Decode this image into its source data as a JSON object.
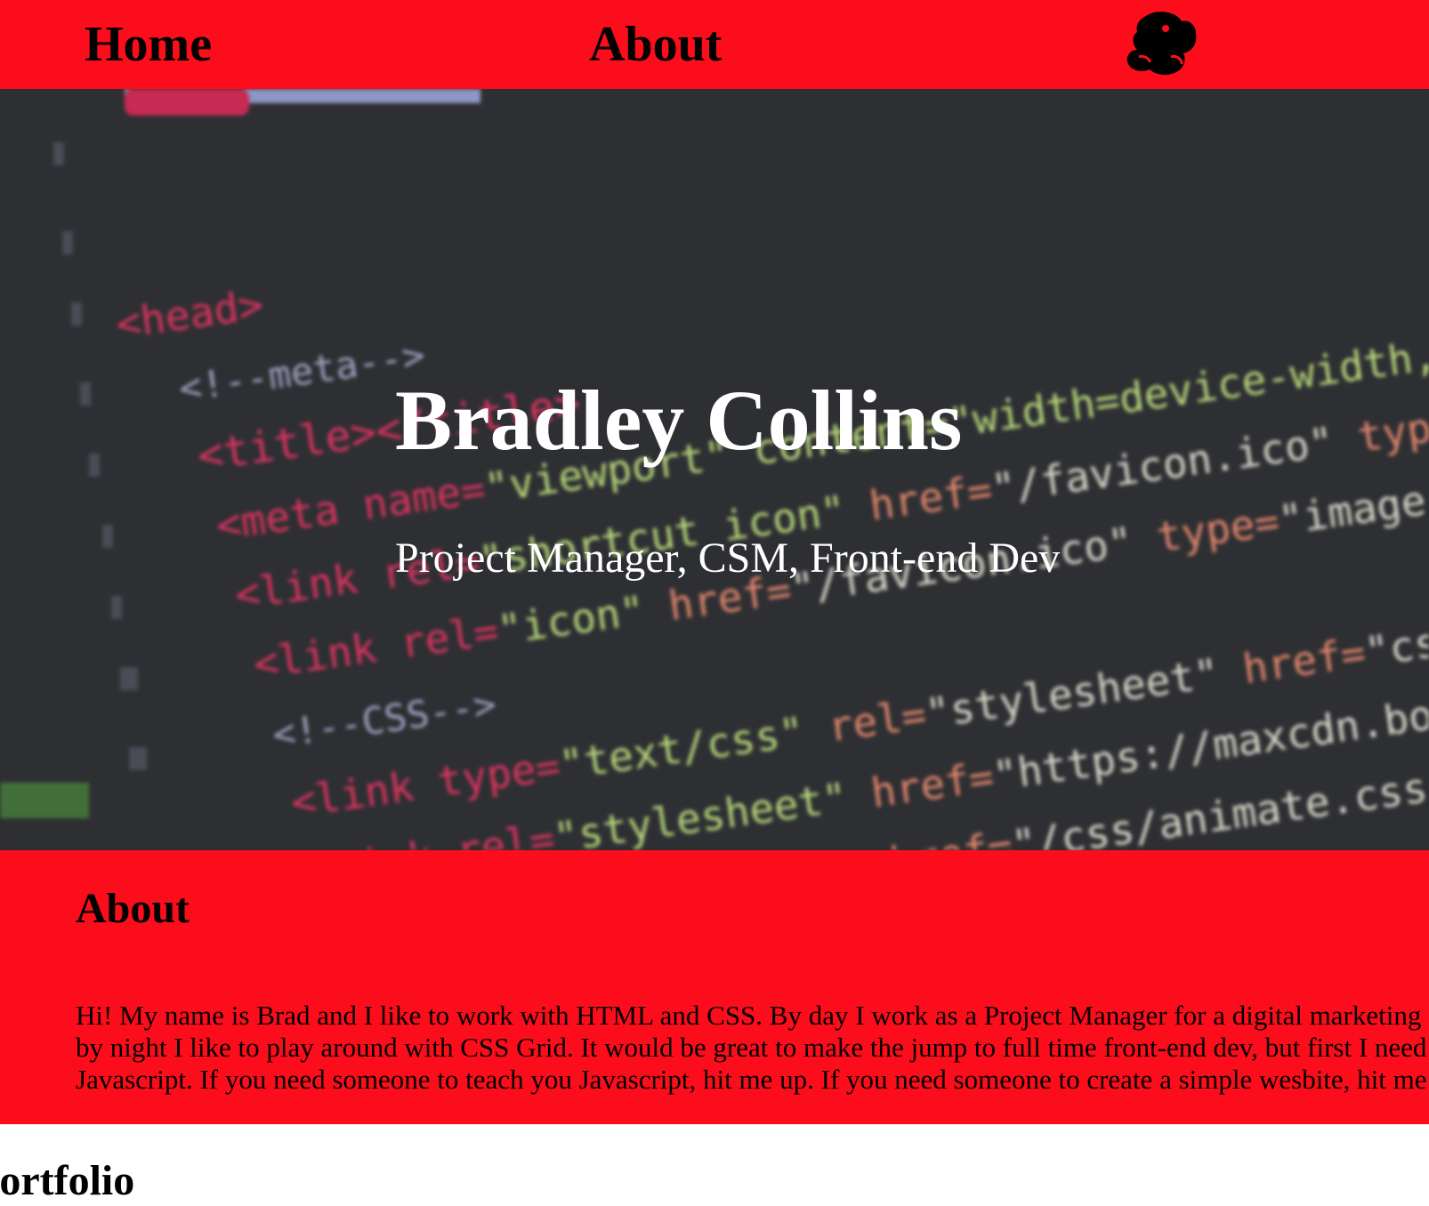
{
  "nav": {
    "home_label": "Home",
    "about_label": "About",
    "logo_icon": "mario-silhouette-icon"
  },
  "hero": {
    "title": "Bradley Collins",
    "subtitle": "Project Manager, CSM, Front-end Dev",
    "background": "blurred-html-code-photo"
  },
  "about": {
    "heading": "About",
    "text": "Hi! My name is Brad and I like to work with HTML and CSS. By day I work as a Project Manager for a digital marketing agency, and by night I like to play around with CSS Grid. It would be great to make the jump to full time front-end dev, but first I need to learn Javascript. If you need someone to teach you Javascript, hit me up. If you need someone to create a simple wesbite, hit me up twice!"
  },
  "next_section": {
    "heading": "Portfolio"
  },
  "colors": {
    "accent_red": "#fc0d1b",
    "hero_bg": "#2e2f33",
    "text_dark": "#000000",
    "text_light": "#ffffff"
  }
}
